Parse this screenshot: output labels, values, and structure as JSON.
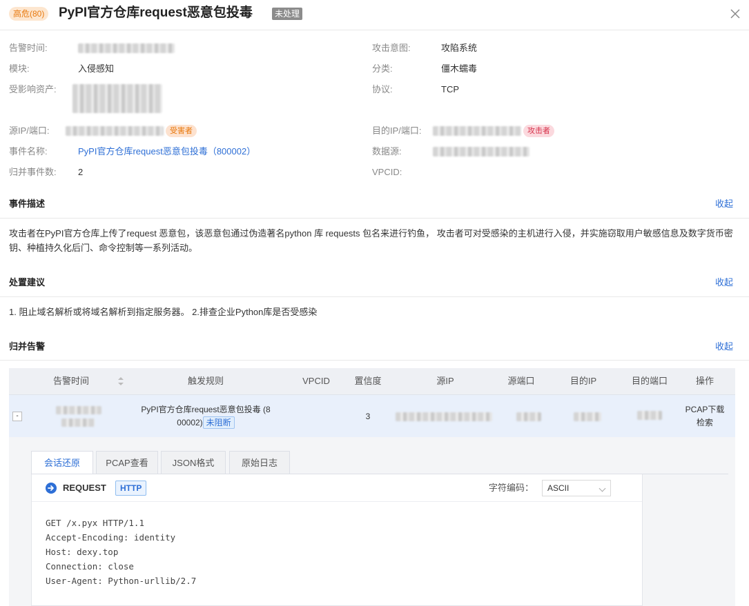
{
  "header": {
    "severity": "高危(80)",
    "title": "PyPI官方仓库request恶意包投毒",
    "status": "未处理"
  },
  "info": {
    "alert_time_label": "告警时间:",
    "module_label": "模块:",
    "module_value": "入侵感知",
    "assets_label": "受影响资产:",
    "src_label": "源IP/端口:",
    "src_role": "受害者",
    "event_label": "事件名称:",
    "event_value": "PyPI官方仓库request恶意包投毒（800002）",
    "merged_label": "归并事件数:",
    "merged_value": "2",
    "intent_label": "攻击意图:",
    "intent_value": "攻陷系统",
    "category_label": "分类:",
    "category_value": "僵木蠕毒",
    "protocol_label": "协议:",
    "protocol_value": "TCP",
    "dst_label": "目的IP/端口:",
    "dst_role": "攻击者",
    "datasource_label": "数据源:",
    "vpcid_label": "VPCID:"
  },
  "description": {
    "title": "事件描述",
    "collapse": "收起",
    "text": "攻击者在PyPI官方仓库上传了request 恶意包，该恶意包通过伪造著名python 库 requests 包名来进行钓鱼， 攻击者可对受感染的主机进行入侵，并实施窃取用户敏感信息及数字货币密钥、种植持久化后门、命令控制等一系列活动。"
  },
  "advice": {
    "title": "处置建议",
    "collapse": "收起",
    "text": "1. 阻止域名解析或将域名解析到指定服务器。 2.排查企业Python库是否受感染"
  },
  "merged_alerts": {
    "title": "归并告警",
    "collapse": "收起",
    "columns": [
      "告警时间",
      "触发规则",
      "VPCID",
      "置信度",
      "源IP",
      "源端口",
      "目的IP",
      "目的端口",
      "操作"
    ],
    "row": {
      "expand": "-",
      "rule_line1": "PyPI官方仓库request恶意包投毒 (8",
      "rule_line2": "00002)",
      "block_status": "未阻断",
      "confidence": "3",
      "action_download": "PCAP下载",
      "action_search": "检索"
    }
  },
  "detail": {
    "tabs": [
      "会话还原",
      "PCAP查看",
      "JSON格式",
      "原始日志"
    ],
    "active_tab": 0,
    "request_title": "REQUEST",
    "protocol_tag": "HTTP",
    "encoding_label": "字符编码：",
    "encoding_value": "ASCII",
    "request_lines": "GET /x.pyx HTTP/1.1\nAccept-Encoding: identity\nHost: dexy.top\nConnection: close\nUser-Agent: Python-urllib/2.7"
  },
  "colors": {
    "accent": "#2e6fd6",
    "severity": "#e8790e",
    "attacker": "#d6314a"
  }
}
